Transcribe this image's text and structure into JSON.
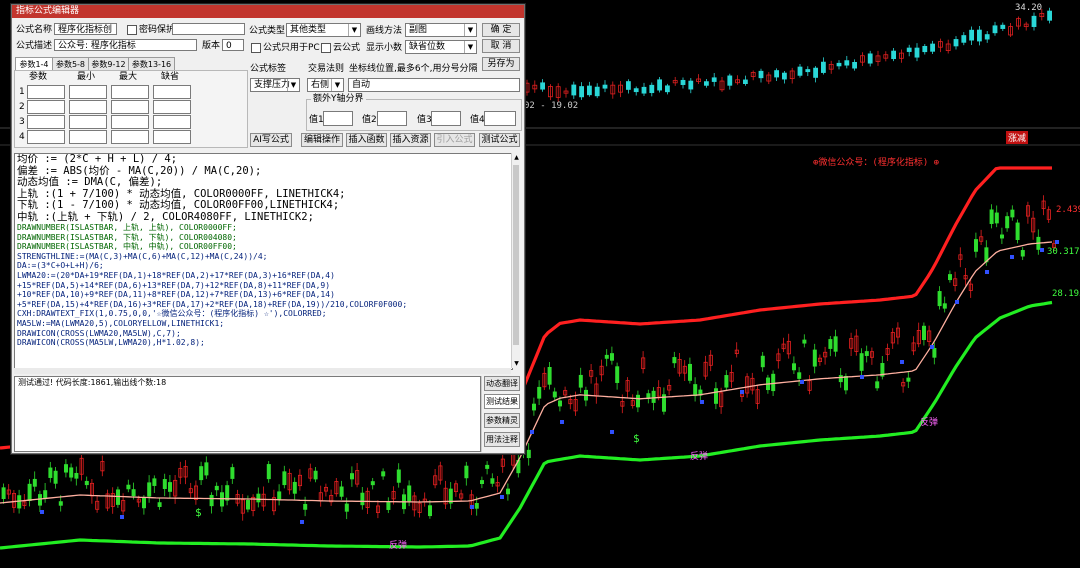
{
  "chart": {
    "price_top_label": "34.20",
    "date_range_label": "02 - 19.02",
    "indicator_tag": "涨减",
    "indicator_title": "⊕微信公众号：(程序化指标) ⊕",
    "level_upper": "2.439",
    "level_mid": "30.317",
    "level_lower": "28.195",
    "buy_marker": "$",
    "rebound_label": "反弹",
    "colors": {
      "upper_band": "#ff2020",
      "middle_band": "#ffb0a0",
      "lower_band": "#22ee22",
      "up_candle": "#e82020",
      "down_candle": "#2fdd2f",
      "top_up": "#e02020",
      "top_down": "#2ad7d7",
      "blue_marker": "#3050ff",
      "magenta_label": "#ff66ff"
    }
  },
  "dialog": {
    "title": "指标公式编辑器",
    "name_label": "公式名称",
    "name_value": "程序化指标创",
    "password_label": "密码保护",
    "desc_label": "公式描述",
    "desc_value": "公众号: 程序化指标",
    "version_label": "版本",
    "version_value": "0",
    "type_label": "公式类型",
    "type_value": "其他类型",
    "draw_label": "画线方法",
    "draw_value": "副图",
    "ok_button": "确  定",
    "cancel_button": "取  消",
    "pc_only_label": "公式只用于PC",
    "cloud_label": "云公式",
    "decimals_label": "显示小数",
    "decimals_value": "缺省位数",
    "save_as_button": "另存为",
    "tabs": [
      "参数1-4",
      "参数5-8",
      "参数9-12",
      "参数13-16"
    ],
    "param_headers": [
      "参数",
      "最小",
      "最大",
      "缺省"
    ],
    "param_rows": [
      "1",
      "2",
      "3",
      "4"
    ],
    "formula_tag_label": "公式标签",
    "trade_rule_label": "交易法则",
    "coord_label": "坐标线位置,最多6个,用分号分隔",
    "support_value": "支撑压力",
    "right_value": "右侧",
    "auto_value": "自动",
    "extra_y_label": "额外Y轴分界",
    "val1_label": "值1",
    "val2_label": "值2",
    "val3_label": "值3",
    "val4_label": "值4",
    "ai_button": "AI写公式",
    "edit_button": "编辑操作",
    "insert_func_button": "插入函数",
    "insert_res_button": "插入资源",
    "import_button": "引入公式",
    "test_button": "测试公式",
    "code_lines": [
      "均价 := (2*C + H + L) / 4;",
      "偏差 := ABS(均价 - MA(C,20)) / MA(C,20);",
      "动态均值 := DMA(C, 偏差);",
      "上轨 :(1 + 7/100) * 动态均值, COLOR0000FF, LINETHICK4;",
      "下轨 :(1 - 7/100) * 动态均值, COLOR00FF00,LINETHICK4;",
      "中轨 :(上轨 + 下轨) / 2, COLOR4080FF, LINETHICK2;",
      "DRAWNUMBER(ISLASTBAR, 上轨, 上轨), COLOR0000FF;",
      "DRAWNUMBER(ISLASTBAR, 下轨, 下轨), COLOR004080;",
      "DRAWNUMBER(ISLASTBAR, 中轨, 中轨), COLOR00FF00;",
      "STRENGTHLINE:=(MA(C,3)+MA(C,6)+MA(C,12)+MA(C,24))/4;",
      "DA:=(3*C+O+L+H)/6;",
      "LWMA20:=(20*DA+19*REF(DA,1)+18*REF(DA,2)+17*REF(DA,3)+16*REF(DA,4)",
      "+15*REF(DA,5)+14*REF(DA,6)+13*REF(DA,7)+12*REF(DA,8)+11*REF(DA,9)",
      "+10*REF(DA,10)+9*REF(DA,11)+8*REF(DA,12)+7*REF(DA,13)+6*REF(DA,14)",
      "+5*REF(DA,15)+4*REF(DA,16)+3*REF(DA,17)+2*REF(DA,18)+REF(DA,19))/210,COLORF0F000;",
      "CXH:DRAWTEXT_FIX(1,0.75,0,0,'☆微信公众号：(程序化指标) ☆'),COLORRED;",
      "MA5LW:=MA(LWMA20,5),COLORYELLOW,LINETHICK1;",
      "DRAWICON(CROSS(LWMA20,MA5LW),C,7);",
      "DRAWICON(CROSS(MA5LW,LWMA20),H*1.02,8);"
    ],
    "result_text": "测试通过! 代码长度:1861,输出线个数:18",
    "side_buttons": [
      "动态翻译",
      "测试结果",
      "参数精灵",
      "用法注释"
    ]
  }
}
